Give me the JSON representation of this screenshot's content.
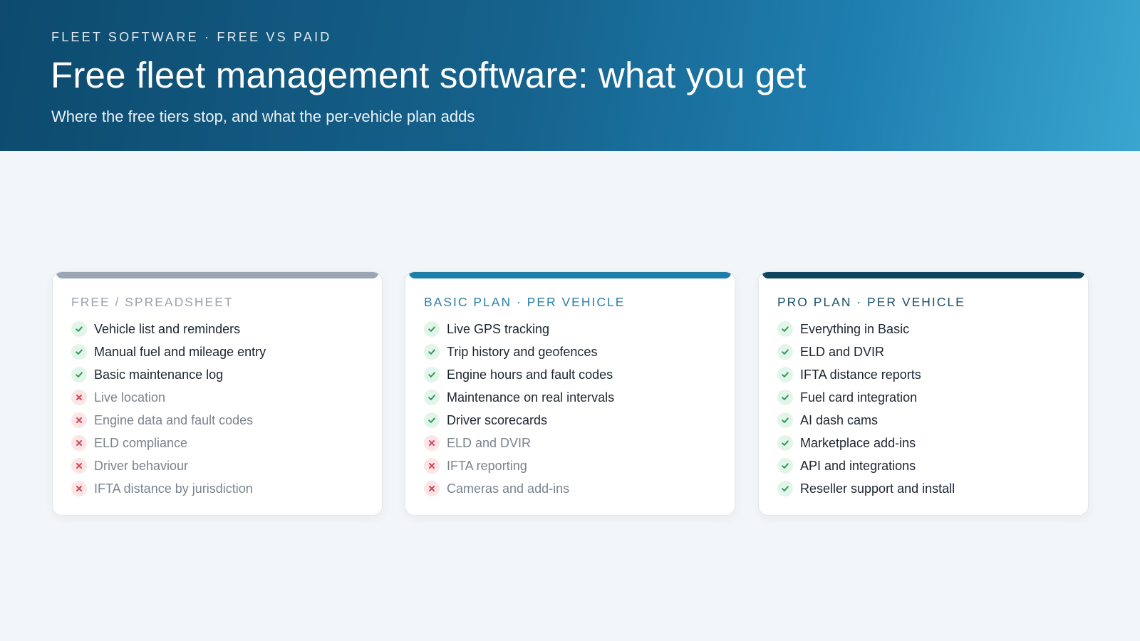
{
  "header": {
    "eyebrow": "FLEET SOFTWARE · FREE VS PAID",
    "title": "Free fleet management software: what you get",
    "subtitle": "Where the free tiers stop, and what the per-vehicle plan adds"
  },
  "colors": {
    "included": "#2f9e5a",
    "excluded": "#d64550",
    "free_accent": "#9aa6b4",
    "basic_accent": "#1f7ea9",
    "pro_accent": "#0f4560"
  },
  "plans": [
    {
      "title": "FREE / SPREADSHEET",
      "features": [
        {
          "label": "Vehicle list and reminders",
          "included": true,
          "icon": "check-icon"
        },
        {
          "label": "Manual fuel and mileage entry",
          "included": true,
          "icon": "check-icon"
        },
        {
          "label": "Basic maintenance log",
          "included": true,
          "icon": "check-icon"
        },
        {
          "label": "Live location",
          "included": false,
          "icon": "cross-icon"
        },
        {
          "label": "Engine data and fault codes",
          "included": false,
          "icon": "cross-icon"
        },
        {
          "label": "ELD compliance",
          "included": false,
          "icon": "cross-icon"
        },
        {
          "label": "Driver behaviour",
          "included": false,
          "icon": "cross-icon"
        },
        {
          "label": "IFTA distance by jurisdiction",
          "included": false,
          "icon": "cross-icon"
        }
      ]
    },
    {
      "title": "BASIC PLAN · PER VEHICLE",
      "features": [
        {
          "label": "Live GPS tracking",
          "included": true,
          "icon": "check-icon"
        },
        {
          "label": "Trip history and geofences",
          "included": true,
          "icon": "check-icon"
        },
        {
          "label": "Engine hours and fault codes",
          "included": true,
          "icon": "check-icon"
        },
        {
          "label": "Maintenance on real intervals",
          "included": true,
          "icon": "check-icon"
        },
        {
          "label": "Driver scorecards",
          "included": true,
          "icon": "check-icon"
        },
        {
          "label": "ELD and DVIR",
          "included": false,
          "icon": "cross-icon"
        },
        {
          "label": "IFTA reporting",
          "included": false,
          "icon": "cross-icon"
        },
        {
          "label": "Cameras and add-ins",
          "included": false,
          "icon": "cross-icon"
        }
      ]
    },
    {
      "title": "PRO PLAN · PER VEHICLE",
      "features": [
        {
          "label": "Everything in Basic",
          "included": true,
          "icon": "check-icon"
        },
        {
          "label": "ELD and DVIR",
          "included": true,
          "icon": "check-icon"
        },
        {
          "label": "IFTA distance reports",
          "included": true,
          "icon": "check-icon"
        },
        {
          "label": "Fuel card integration",
          "included": true,
          "icon": "check-icon"
        },
        {
          "label": "AI dash cams",
          "included": true,
          "icon": "check-icon"
        },
        {
          "label": "Marketplace add-ins",
          "included": true,
          "icon": "check-icon"
        },
        {
          "label": "API and integrations",
          "included": true,
          "icon": "check-icon"
        },
        {
          "label": "Reseller support and install",
          "included": true,
          "icon": "check-icon"
        }
      ]
    }
  ]
}
